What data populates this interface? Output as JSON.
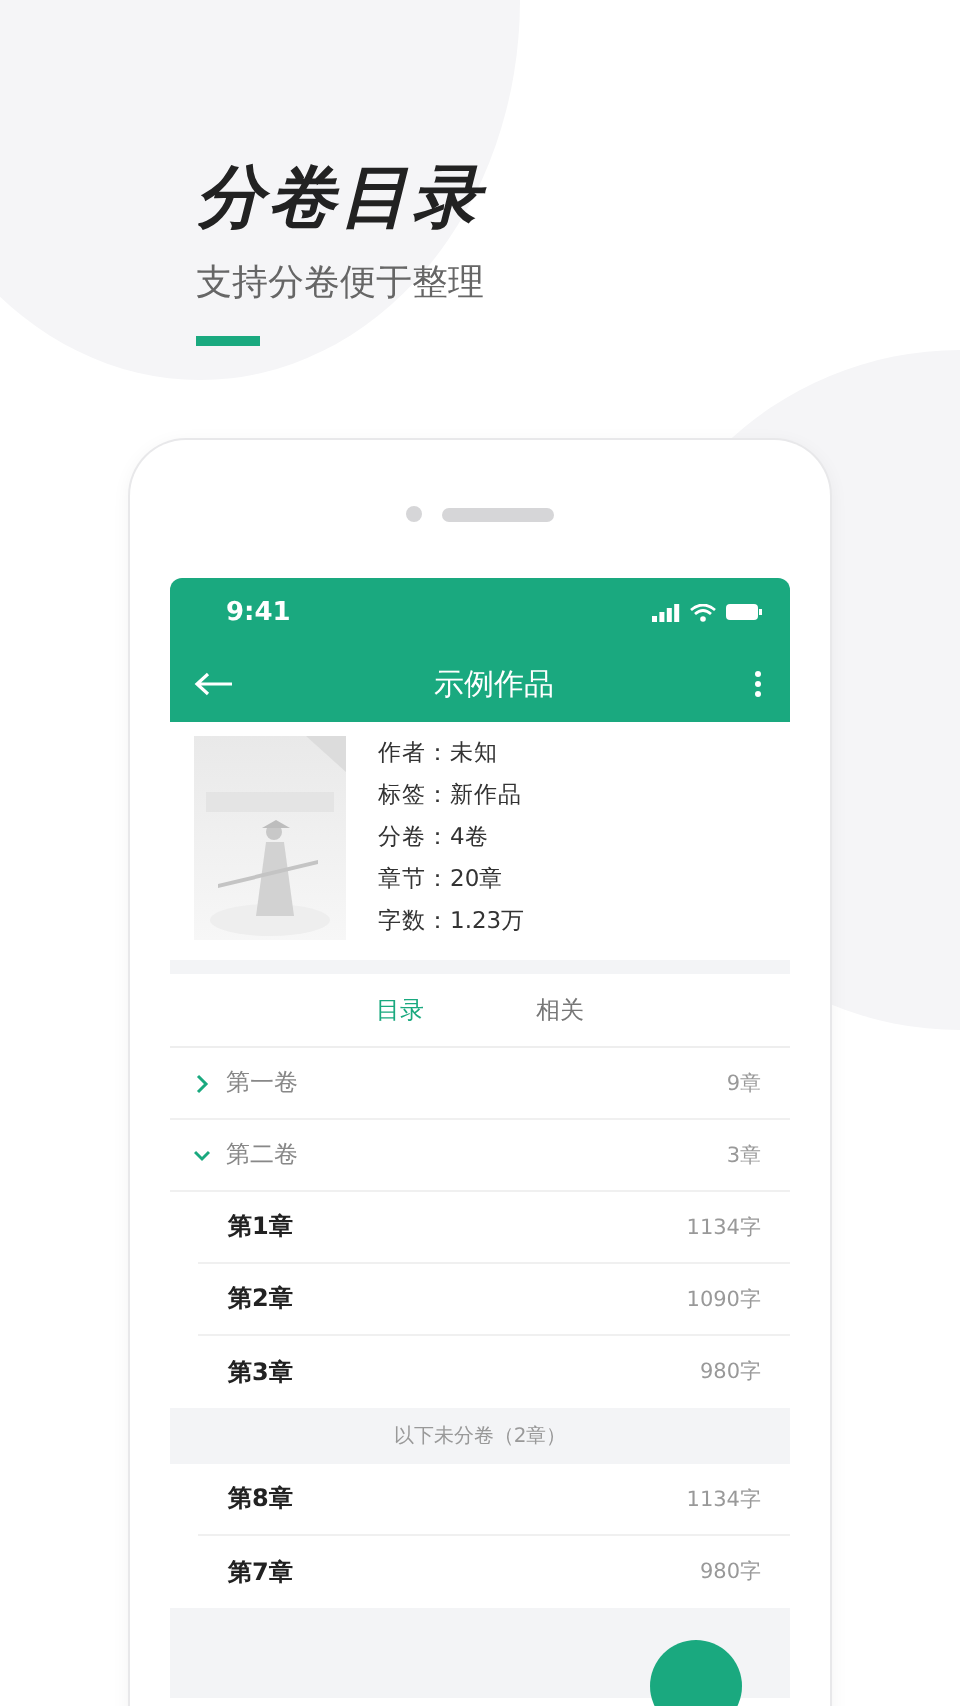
{
  "promo": {
    "title": "分卷目录",
    "subtitle": "支持分卷便于整理"
  },
  "status_bar": {
    "time": "9:41"
  },
  "nav": {
    "title": "示例作品"
  },
  "book": {
    "fields": [
      "作者：未知",
      "标签：新作品",
      "分卷：4卷",
      "章节：20章",
      "字数：1.23万"
    ]
  },
  "tabs": [
    {
      "label": "目录",
      "selected": true
    },
    {
      "label": "相关",
      "selected": false
    }
  ],
  "volumes": [
    {
      "title": "第一卷",
      "count": "9章",
      "expanded": false
    },
    {
      "title": "第二卷",
      "count": "3章",
      "expanded": true,
      "children": [
        {
          "title": "第1章",
          "words": "1134字"
        },
        {
          "title": "第2章",
          "words": "1090字"
        },
        {
          "title": "第3章",
          "words": "980字"
        }
      ]
    }
  ],
  "unassigned": {
    "label": "以下未分卷（2章）",
    "chapters": [
      {
        "title": "第8章",
        "words": "1134字"
      },
      {
        "title": "第7章",
        "words": "980字"
      }
    ]
  }
}
